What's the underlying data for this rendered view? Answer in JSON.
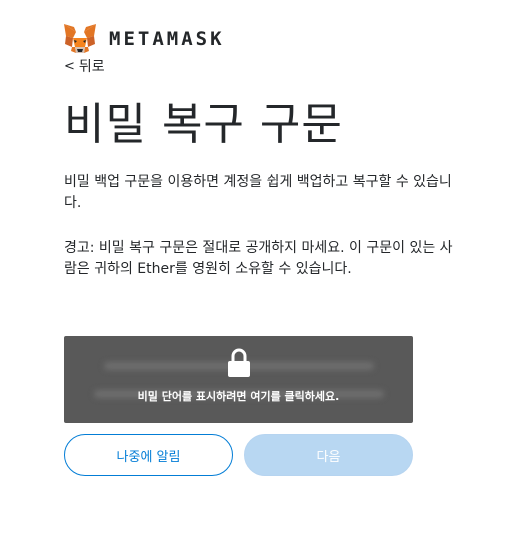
{
  "header": {
    "logo_icon": "metamask-fox-icon",
    "logo_text": "METAMASK"
  },
  "nav": {
    "back_label": "뒤로"
  },
  "main": {
    "title": "비밀 복구 구문",
    "description": "비밀 백업 구문을 이용하면 계정을 쉽게 백업하고 복구할 수 있습니다.",
    "warning": "경고: 비밀 복구 구문은 절대로 공개하지 마세요. 이 구문이 있는 사람은 귀하의 Ether를 영원히 소유할 수 있습니다."
  },
  "reveal": {
    "icon": "lock-icon",
    "text": "비밀 단어를 표시하려면 여기를 클릭하세요."
  },
  "buttons": {
    "later_label": "나중에 알림",
    "next_label": "다음"
  },
  "colors": {
    "accent": "#037dd6",
    "reveal_bg": "#595959",
    "disabled_bg": "#b8d7f2",
    "fox_orange": "#e2761b"
  }
}
